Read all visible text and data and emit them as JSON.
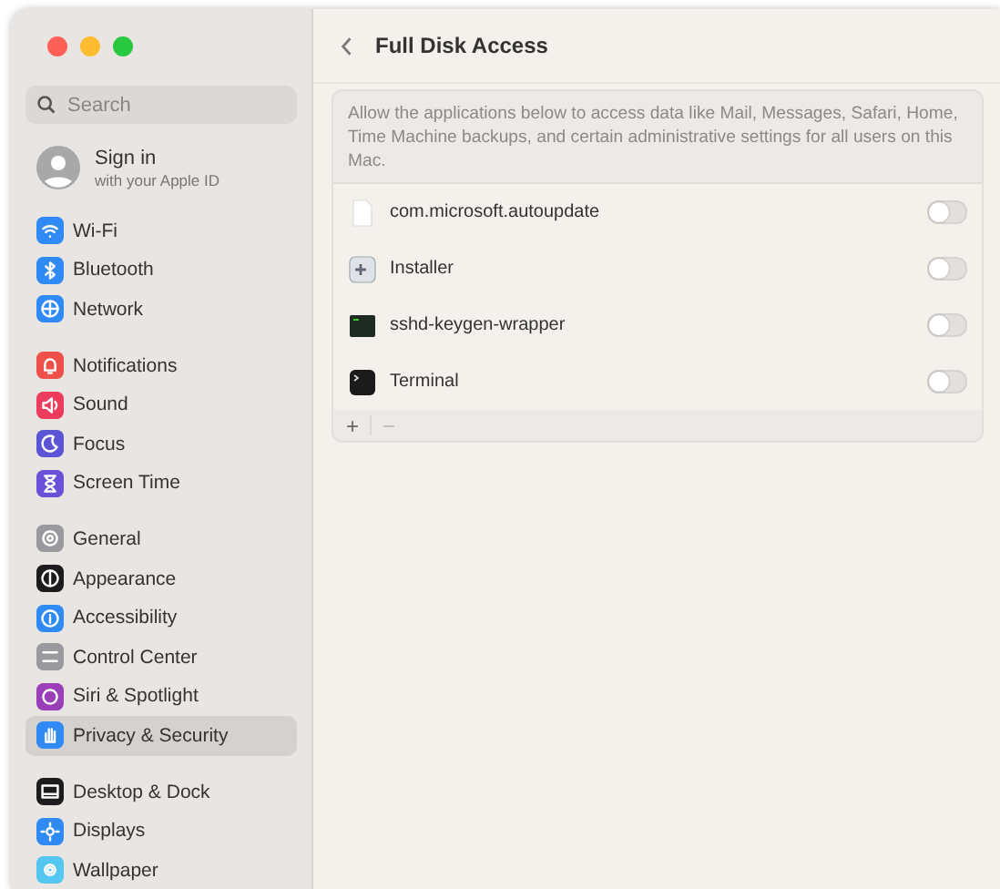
{
  "window": {
    "title": "Full Disk Access"
  },
  "sidebar": {
    "search": {
      "placeholder": "Search"
    },
    "account": {
      "name": "Sign in",
      "subtitle": "with your Apple ID"
    },
    "groups": [
      {
        "items": [
          {
            "label": "Wi-Fi",
            "color": "#2f8af5",
            "selected": false
          },
          {
            "label": "Bluetooth",
            "color": "#2f8af5",
            "selected": false
          },
          {
            "label": "Network",
            "color": "#2f8af5",
            "selected": false
          }
        ]
      },
      {
        "items": [
          {
            "label": "Notifications",
            "color": "#f0504a",
            "selected": false
          },
          {
            "label": "Sound",
            "color": "#ec3b5c",
            "selected": false
          },
          {
            "label": "Focus",
            "color": "#5b55d6",
            "selected": false
          },
          {
            "label": "Screen Time",
            "color": "#6a52d8",
            "selected": false
          }
        ]
      },
      {
        "items": [
          {
            "label": "General",
            "color": "#9a9a9e",
            "selected": false
          },
          {
            "label": "Appearance",
            "color": "#1c1c1e",
            "selected": false
          },
          {
            "label": "Accessibility",
            "color": "#2f8af5",
            "selected": false
          },
          {
            "label": "Control Center",
            "color": "#9a9a9e",
            "selected": false
          },
          {
            "label": "Siri & Spotlight",
            "color": "#9b3fb8",
            "selected": false
          },
          {
            "label": "Privacy & Security",
            "color": "#2f8af5",
            "selected": true
          }
        ]
      },
      {
        "items": [
          {
            "label": "Desktop & Dock",
            "color": "#1c1c1e",
            "selected": false
          },
          {
            "label": "Displays",
            "color": "#2f8af5",
            "selected": false
          },
          {
            "label": "Wallpaper",
            "color": "#55c6f0",
            "selected": false
          }
        ]
      }
    ]
  },
  "content": {
    "description": "Allow the applications below to access data like Mail, Messages, Safari, Home, Time Machine backups, and certain administrative settings for all users on this Mac.",
    "apps": [
      {
        "name": "com.microsoft.autoupdate",
        "on": false
      },
      {
        "name": "Installer",
        "on": false
      },
      {
        "name": "sshd-keygen-wrapper",
        "on": false
      },
      {
        "name": "Terminal",
        "on": false
      }
    ],
    "footer": {
      "add": "+",
      "remove": "−"
    }
  }
}
